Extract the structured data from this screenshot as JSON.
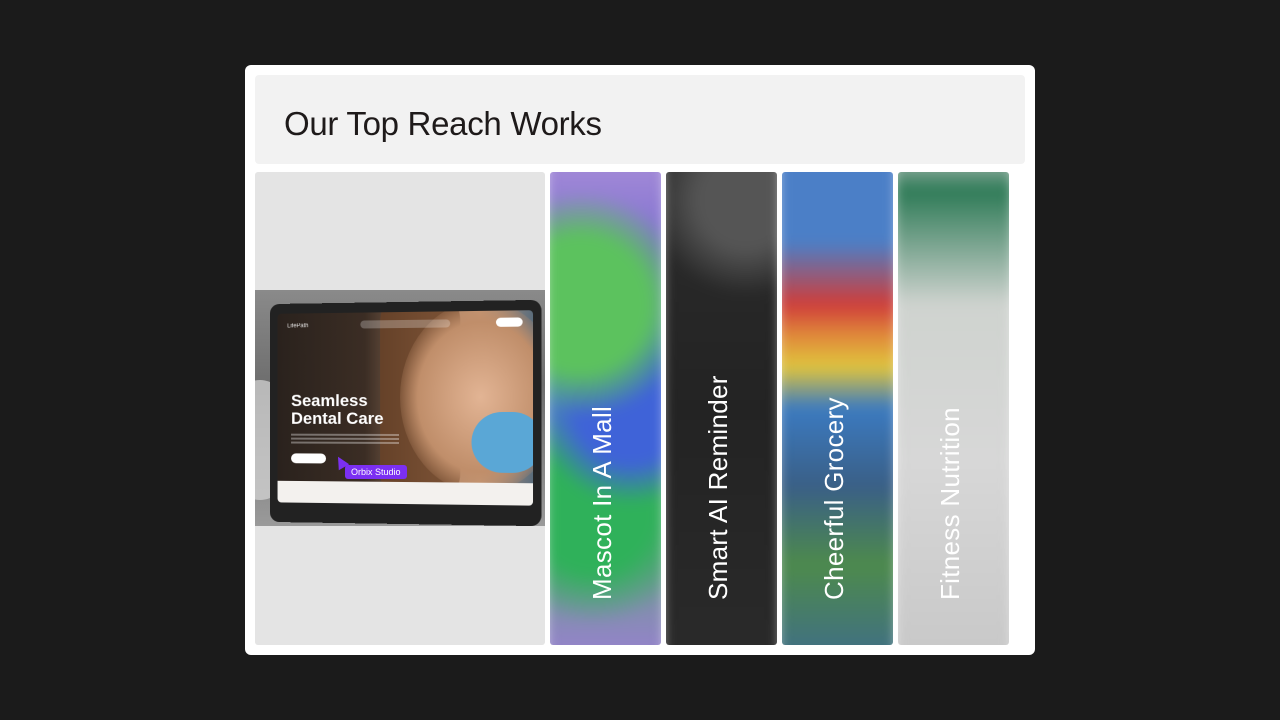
{
  "header": {
    "title": "Our Top Reach Works"
  },
  "featured": {
    "mockup": {
      "brand": "LifePath",
      "headline": "Seamless Dental Care",
      "tag": "Orbix Studio"
    }
  },
  "projects": [
    {
      "label": "Mascot In A Mall"
    },
    {
      "label": "Smart AI Reminder"
    },
    {
      "label": "Cheerful Grocery"
    },
    {
      "label": "Fitness Nutrition"
    }
  ],
  "colors": {
    "page_bg": "#1b1b1b",
    "card_bg": "#ffffff",
    "header_bg": "#f2f2f2",
    "tag_accent": "#7b2ff2"
  }
}
